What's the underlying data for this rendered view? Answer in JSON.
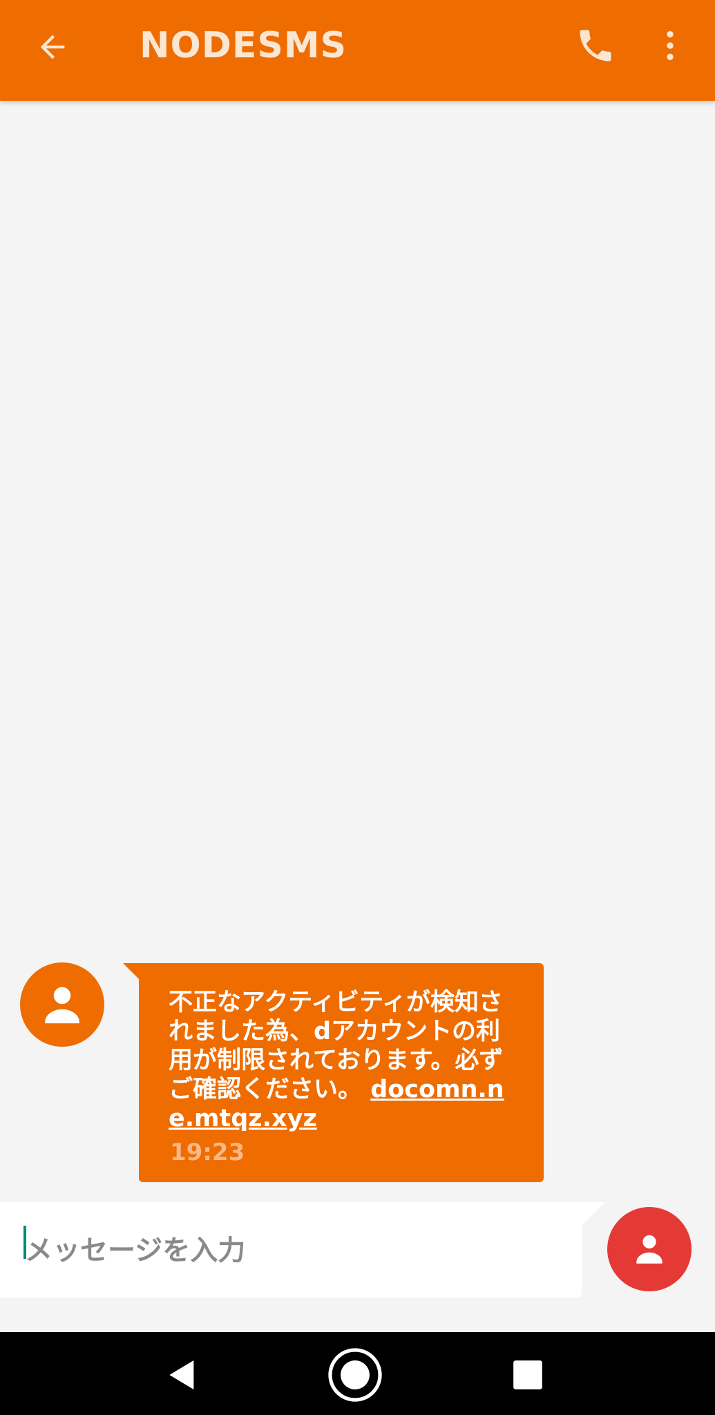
{
  "app_bar": {
    "title": "NODESMS",
    "background_color": "#ef6c00",
    "back_icon": "arrow-back-icon",
    "call_icon": "phone-icon",
    "more_icon": "more-vert-icon"
  },
  "message": {
    "sender_avatar_icon": "person-icon",
    "body": "不正なアクティビティが検知されました為、dアカウントの利用が制限されております。必ずご確認ください。",
    "link": "docomn.ne.mtqz.xyz",
    "time": "19:23",
    "bubble_color": "#ef6c00"
  },
  "composer": {
    "placeholder": "メッセージを入力",
    "value": "",
    "contact_button_icon": "person-icon",
    "contact_button_color": "#e53935"
  },
  "nav_bar": {
    "back_icon": "nav-back-icon",
    "home_icon": "nav-home-icon",
    "recents_icon": "nav-recents-icon"
  }
}
